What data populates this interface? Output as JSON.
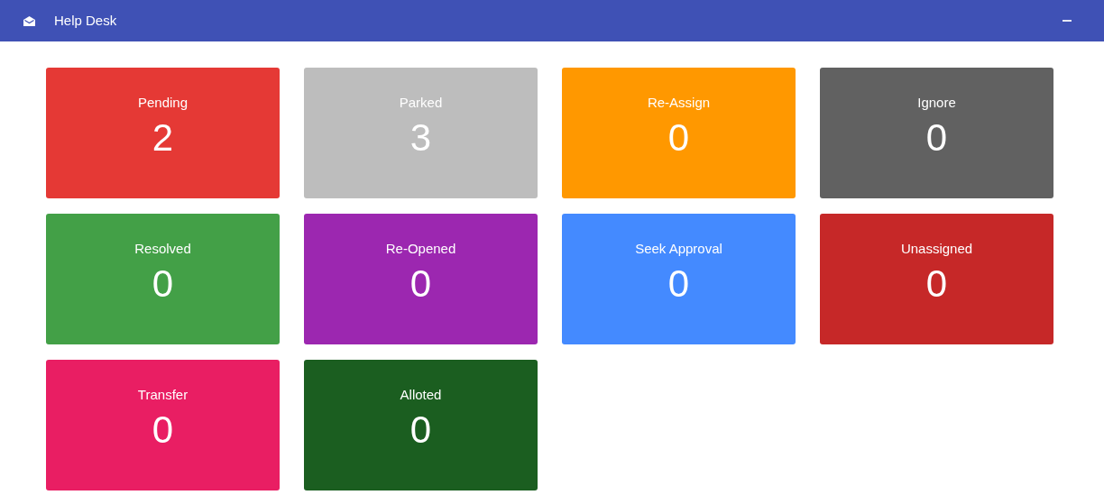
{
  "window": {
    "title": "Help Desk"
  },
  "tiles": [
    {
      "label": "Pending",
      "count": "2",
      "color": "#e53935"
    },
    {
      "label": "Parked",
      "count": "3",
      "color": "#bdbdbd"
    },
    {
      "label": "Re-Assign",
      "count": "0",
      "color": "#ff9800"
    },
    {
      "label": "Ignore",
      "count": "0",
      "color": "#616161"
    },
    {
      "label": "Resolved",
      "count": "0",
      "color": "#43a047"
    },
    {
      "label": "Re-Opened",
      "count": "0",
      "color": "#9c27b0"
    },
    {
      "label": "Seek Approval",
      "count": "0",
      "color": "#448aff"
    },
    {
      "label": "Unassigned",
      "count": "0",
      "color": "#c62828"
    },
    {
      "label": "Transfer",
      "count": "0",
      "color": "#e91e63"
    },
    {
      "label": "Alloted",
      "count": "0",
      "color": "#1b5e20"
    }
  ]
}
